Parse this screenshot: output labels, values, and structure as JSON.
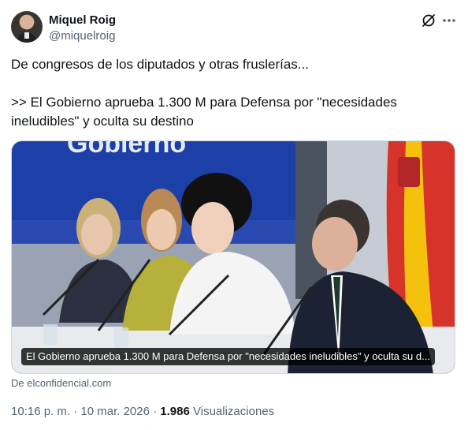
{
  "author": {
    "name": "Miquel Roig",
    "handle": "@miquelroig"
  },
  "tweet": {
    "line1": "De congresos de los diputados y otras fruslerías...",
    "line2": ">> El Gobierno aprueba 1.300 M para Defensa por \"necesidades",
    "line3": "ineludibles\" y oculta su destino"
  },
  "card": {
    "caption": "El Gobierno aprueba 1.300 M para Defensa por \"necesidades ineludibles\" y oculta su d...",
    "backdrop_text": "Gobierno",
    "source": "De elconfidencial.com"
  },
  "meta": {
    "time": "10:16 p. m.",
    "separator": "·",
    "date": "10 mar. 2026",
    "views_count": "1.986",
    "views_label": "Visualizaciones"
  },
  "icons": {
    "grok": "grok-icon",
    "more": "more-horizontal-icon"
  }
}
